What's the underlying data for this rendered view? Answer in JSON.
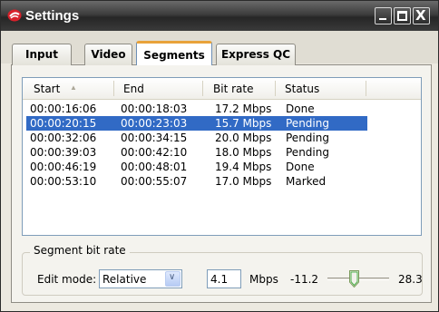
{
  "window": {
    "title": "Settings",
    "controls": [
      "minimize-icon",
      "maximize-icon",
      "close-icon"
    ],
    "close_glyph": "X"
  },
  "tabs": [
    {
      "label": "Input",
      "active": false
    },
    {
      "label": "Video",
      "active": false
    },
    {
      "label": "Segments",
      "active": true
    },
    {
      "label": "Express QC",
      "active": false
    }
  ],
  "segments": {
    "columns": [
      "Start",
      "End",
      "Bit rate",
      "Status"
    ],
    "sort_column": "Start",
    "rows": [
      {
        "start": "00:00:16:06",
        "end": "00:00:18:03",
        "bitrate": "17.2 Mbps",
        "status": "Done",
        "selected": false
      },
      {
        "start": "00:00:20:15",
        "end": "00:00:23:03",
        "bitrate": "15.7 Mbps",
        "status": "Pending",
        "selected": true
      },
      {
        "start": "00:00:32:06",
        "end": "00:00:34:15",
        "bitrate": "20.0 Mbps",
        "status": "Pending",
        "selected": false
      },
      {
        "start": "00:00:39:03",
        "end": "00:00:42:10",
        "bitrate": "18.0 Mbps",
        "status": "Pending",
        "selected": false
      },
      {
        "start": "00:00:46:19",
        "end": "00:00:48:01",
        "bitrate": "19.4 Mbps",
        "status": "Done",
        "selected": false
      },
      {
        "start": "00:00:53:10",
        "end": "00:00:55:07",
        "bitrate": "17.0 Mbps",
        "status": "Marked",
        "selected": false
      }
    ]
  },
  "bitrate_group": {
    "title": "Segment bit rate",
    "edit_mode_label": "Edit mode:",
    "edit_mode_value": "Relative",
    "value": "4.1",
    "unit": "Mbps",
    "slider_min": "-11.2",
    "slider_max": "28.3",
    "slider_position": 0.37
  },
  "colors": {
    "selection": "#316ac5",
    "active_tab_accent": "#e8a23a",
    "title_bar": "#2c2c2c"
  }
}
